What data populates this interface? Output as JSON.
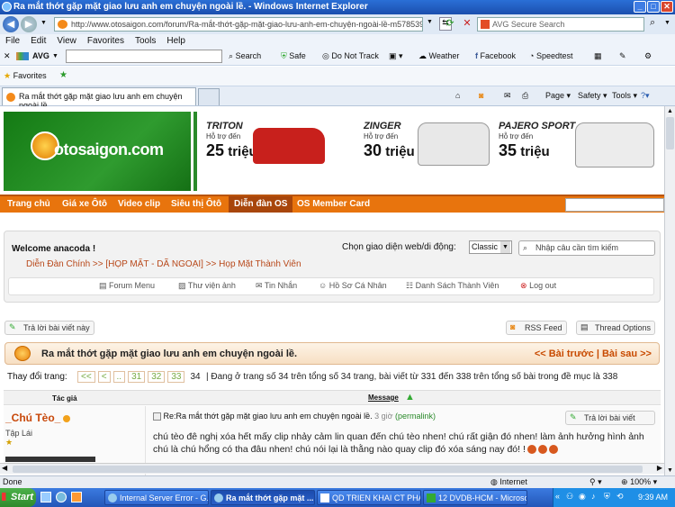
{
  "window": {
    "title": "Ra mắt thớt gặp mặt giao lưu anh em chuyện ngoài lề. - Windows Internet Explorer"
  },
  "address": {
    "url": "http://www.otosaigon.com/forum/Ra-mắt-thớt-gặp-mặt-giao-lưu-anh-em-chuyện-ngoài-lề-m5785397-p34.aspx",
    "search_engine": "AVG Secure Search"
  },
  "menu": [
    "File",
    "Edit",
    "View",
    "Favorites",
    "Tools",
    "Help"
  ],
  "toolbar": {
    "avg": "AVG",
    "search": "Search",
    "safe": "Safe",
    "donottrack": "Do Not Track",
    "weather": "Weather",
    "facebook": "Facebook",
    "speedtest": "Speedtest"
  },
  "favorites": {
    "label": "Favorites"
  },
  "tab": {
    "title": "Ra mắt thớt gặp mặt giao lưu anh em chuyện ngoài lề."
  },
  "commandbar": {
    "page": "Page",
    "safety": "Safety",
    "tools": "Tools"
  },
  "site": {
    "logo": "otosaigon.com",
    "ads": [
      {
        "name": "TRITON",
        "sub": "Hỗ trợ đến",
        "amount": "25",
        "unit": "triệu"
      },
      {
        "name": "ZINGER",
        "sub": "Hỗ trợ đến",
        "amount": "30",
        "unit": "triệu"
      },
      {
        "name": "PAJERO SPORT",
        "sub": "Hỗ trợ đến",
        "amount": "35",
        "unit": "triệu"
      }
    ],
    "nav": [
      "Trang chủ",
      "Giá xe Ôtô",
      "Video clip",
      "Siêu thị Ôtô",
      "Diễn đàn OS",
      "OS Member Card"
    ]
  },
  "welcome": {
    "title": "Welcome anacoda !",
    "theme_label": "Chọn giao diện web/di động:",
    "theme_value": "Classic",
    "search_placeholder": "Nhập câu cần tìm kiếm",
    "breadcrumb": "Diễn Đàn Chính >> [HỌP MẶT - DÃ NGOẠI] >> Họp Mặt Thành Viên",
    "menu": [
      "Forum Menu",
      "Thư viện ảnh",
      "Tin Nhắn",
      "Hồ Sơ Cá Nhân",
      "Danh Sách Thành Viên",
      "Log out"
    ]
  },
  "actions": {
    "reply": "Trả lời bài viết này",
    "rss": "RSS Feed",
    "options": "Thread Options"
  },
  "thread": {
    "title": "Ra mắt thớt gặp mặt giao lưu anh em chuyện ngoài lề.",
    "prev": "<< Bài trước",
    "sep": "|",
    "next": "Bài sau >>",
    "pager_label": "Thay đổi trang:",
    "pages": [
      "<<",
      "<",
      "..",
      "31",
      "32",
      "33",
      "34"
    ],
    "page_info": "| Đang ở trang số 34 trên tổng số 34 trang, bài viết từ 331 đến 338 trên tổng số bài trong đề mục là 338",
    "col_author": "Tác giả",
    "col_message": "Message"
  },
  "post": {
    "author": "_Chú Tèo_",
    "rank": "Tập Lái",
    "subject": "Re:Ra mắt thớt gặp mặt giao lưu anh em chuyện ngoài lề.",
    "time": "3 giờ",
    "permalink": "(permalink)",
    "reply": "Trả lời bài viết",
    "body": "chú tèo đê nghị xóa hết mấy clip nhảy cảm lin quan đến chú tèo nhen! chú rất giận đó nhen! làm ảnh hưởng hình ảnh chú là chú hổng có tha đâu nhen! chú nói lại là thằng nào quay clip đó xóa sáng nay đó! !"
  },
  "statusbar": {
    "left": "Done",
    "zone": "Internet",
    "zoom": "100%"
  },
  "taskbar": {
    "start": "Start",
    "tasks": [
      "Internal Server Error - G...",
      "Ra mắt thớt gặp mặt ...",
      "QD TRIEN KHAI CT PHAT...",
      "12 DVDB-HCM - Microsof..."
    ],
    "time": "9:39 AM"
  }
}
